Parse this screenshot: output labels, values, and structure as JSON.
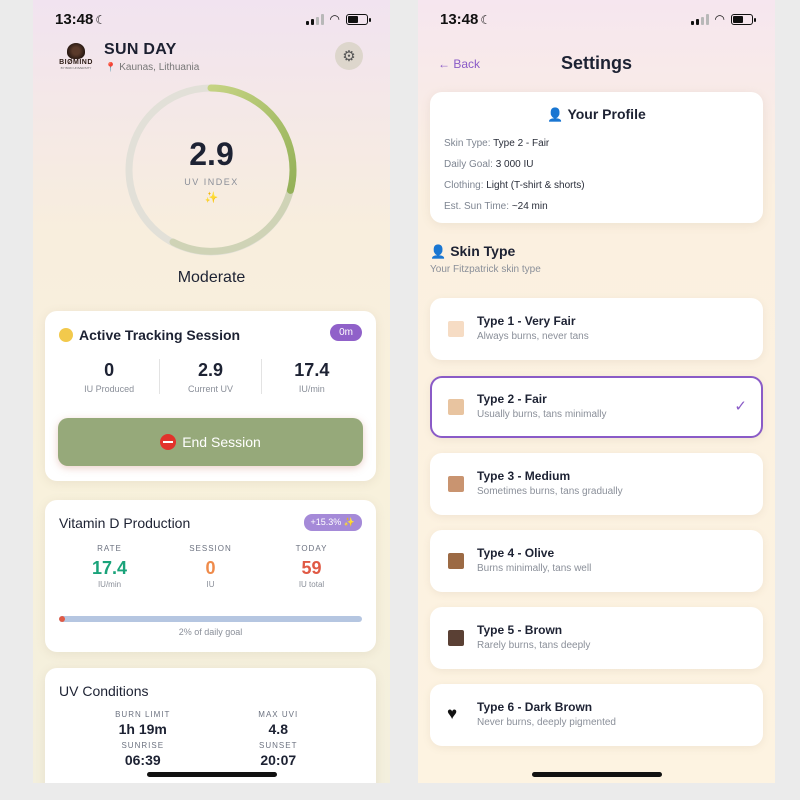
{
  "left": {
    "status": {
      "time": "13:48"
    },
    "brand": {
      "logo_text": "BIØMIND",
      "logo_sub": "BY BIRD UNIVERSITY"
    },
    "header": {
      "title": "SUN DAY",
      "location": "Kaunas, Lithuania"
    },
    "uv": {
      "value": "2.9",
      "label": "UV INDEX",
      "sparkle": "✨",
      "level": "Moderate",
      "fraction": 0.29
    },
    "tracking": {
      "title": "Active Tracking Session",
      "badge": "0m",
      "stats": [
        {
          "value": "0",
          "label": "IU Produced"
        },
        {
          "value": "2.9",
          "label": "Current UV"
        },
        {
          "value": "17.4",
          "label": "IU/min"
        }
      ],
      "end_button": "End Session"
    },
    "vitamin_d": {
      "title": "Vitamin D Production",
      "badge": "+15.3% ✨",
      "cols": [
        {
          "header": "RATE",
          "value": "17.4",
          "unit": "IU/min",
          "color": "#1aa37a"
        },
        {
          "header": "SESSION",
          "value": "0",
          "unit": "IU",
          "color": "#ef8b4b"
        },
        {
          "header": "TODAY",
          "value": "59",
          "unit": "IU total",
          "color": "#e05a45"
        }
      ],
      "progress_fraction": 0.02,
      "progress_text": "2% of daily goal"
    },
    "uv_conditions": {
      "title": "UV Conditions",
      "cells": [
        {
          "header": "BURN LIMIT",
          "value": "1h 19m"
        },
        {
          "header": "MAX UVI",
          "value": "4.8"
        },
        {
          "header": "SUNRISE",
          "value": "06:39"
        },
        {
          "header": "SUNSET",
          "value": "20:07"
        }
      ]
    }
  },
  "right": {
    "status": {
      "time": "13:48"
    },
    "nav": {
      "back": "← Back",
      "title": "Settings"
    },
    "profile": {
      "title": "Your Profile",
      "rows": [
        {
          "key": "Skin Type:",
          "value": "Type 2 - Fair"
        },
        {
          "key": "Daily Goal:",
          "value": "3 000 IU"
        },
        {
          "key": "Clothing:",
          "value": "Light (T-shirt & shorts)"
        },
        {
          "key": "Est. Sun Time:",
          "value": "~24 min"
        }
      ]
    },
    "skin_section": {
      "title": "Skin Type",
      "subtitle": "Your Fitzpatrick skin type"
    },
    "skin_types": [
      {
        "name": "Type 1 - Very Fair",
        "desc": "Always burns, never tans",
        "color": "#f6dcc4"
      },
      {
        "name": "Type 2 - Fair",
        "desc": "Usually burns, tans minimally",
        "color": "#e8c4a0",
        "selected": true
      },
      {
        "name": "Type 3 - Medium",
        "desc": "Sometimes burns, tans gradually",
        "color": "#c99470"
      },
      {
        "name": "Type 4 - Olive",
        "desc": "Burns minimally, tans well",
        "color": "#9c6a44"
      },
      {
        "name": "Type 5 - Brown",
        "desc": "Rarely burns, tans deeply",
        "color": "#5a4034"
      },
      {
        "name": "Type 6 - Dark Brown",
        "desc": "Never burns, deeply pigmented",
        "icon": "black-heart-icon"
      }
    ]
  }
}
